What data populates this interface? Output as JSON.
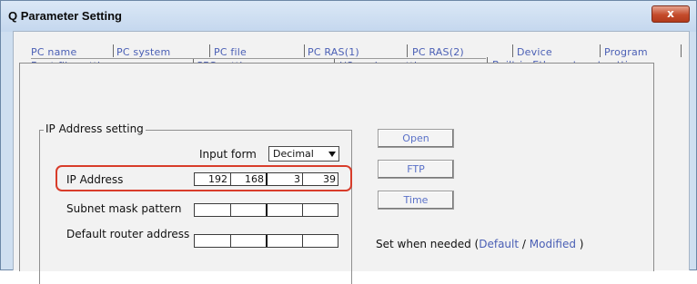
{
  "window": {
    "title": "Q Parameter Setting",
    "close_label": "x"
  },
  "tabs_row1": [
    "PC name",
    "PC system",
    "PC file",
    "PC RAS(1)",
    "PC RAS(2)",
    "Device",
    "Program"
  ],
  "tabs_row2": [
    "Boot file setting",
    "SFC setting",
    "I/O assign setting",
    "Built-in Ethernet port setting"
  ],
  "ip_section": {
    "legend": "IP Address setting",
    "input_form_label": "Input form",
    "input_form_value": "Decimal",
    "ip_address_label": "IP Address",
    "ip_address": [
      "192",
      "168",
      "3",
      "39"
    ],
    "subnet_label": "Subnet mask pattern",
    "subnet": [
      "",
      "",
      "",
      ""
    ],
    "router_label": "Default router address",
    "router": [
      "",
      "",
      "",
      ""
    ]
  },
  "buttons": {
    "open": "Open",
    "ftp": "FTP",
    "time": "Time"
  },
  "note": {
    "prefix": "Set when needed (",
    "default": "Default",
    "sep": " / ",
    "modified": "Modified",
    "suffix": " )"
  },
  "colors": {
    "tab_text": "#4a5fb5",
    "highlight": "#d83c2a",
    "title_bar": "#c4d7ee"
  }
}
